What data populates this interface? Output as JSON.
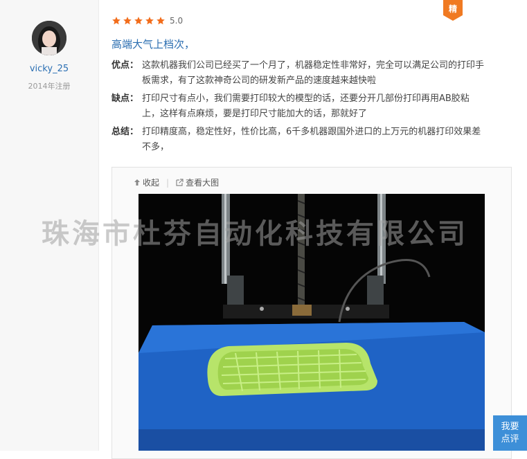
{
  "user": {
    "name": "vicky_25",
    "registered": "2014年注册"
  },
  "review": {
    "rating_text": "5.0",
    "stars": 5,
    "featured_badge": "精",
    "title": "高端大气上档次，",
    "pros_label": "优点：",
    "pros_line1": "这款机器我们公司已经买了一个月了，机器稳定性非常好，完全可以满足公司的打印手",
    "pros_line2": "板需求，有了这款神奇公司的研发新产品的速度越来越快啦",
    "cons_label": "缺点：",
    "cons_line1": "打印尺寸有点小，我们需要打印较大的模型的话，还要分开几部份打印再用AB胶粘",
    "cons_line2": "上，这样有点麻烦，要是打印尺寸能加大的话，那就好了",
    "summary_label": "总结：",
    "summary_line1": "打印精度高，稳定性好，性价比高，6千多机器跟国外进口的上万元的机器打印效果差",
    "summary_line2": "不多，"
  },
  "image_toolbar": {
    "collapse": "收起",
    "view_large": "查看大图"
  },
  "watermark": "珠海市杜芬自动化科技有限公司",
  "float_button": {
    "line1": "我要",
    "line2": "点评"
  },
  "colors": {
    "star": "#f26d1b",
    "badge": "#f07a22",
    "title": "#2a6db0",
    "button": "#3d8fd8"
  }
}
